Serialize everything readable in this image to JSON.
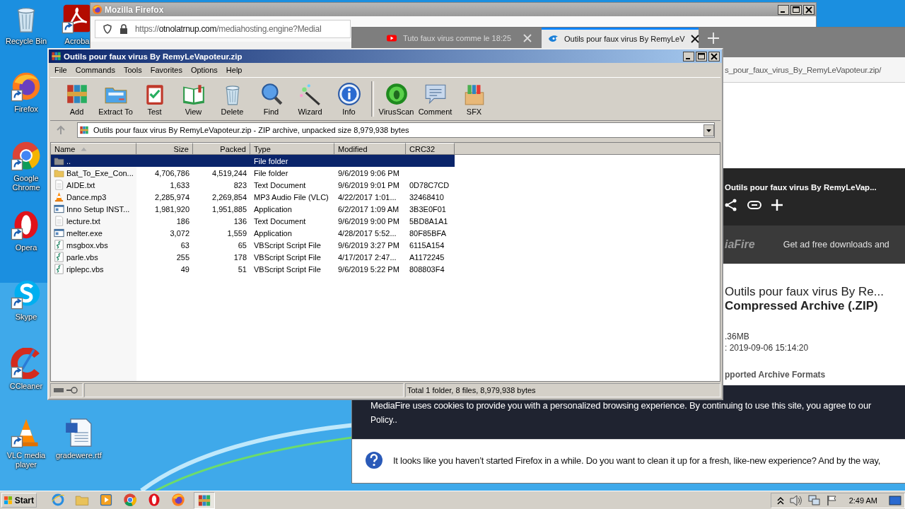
{
  "desktop_icons": [
    {
      "label": "Recycle Bin",
      "kind": "recycle",
      "shortcut": false
    },
    {
      "label": "Acroba",
      "kind": "acrobat",
      "shortcut": true
    },
    {
      "label": "Firefox",
      "kind": "firefox",
      "shortcut": true
    },
    {
      "label": "Google Chrome",
      "kind": "chrome",
      "shortcut": true
    },
    {
      "label": "Opera",
      "kind": "opera",
      "shortcut": true
    },
    {
      "label": "Skype",
      "kind": "skype",
      "shortcut": true
    },
    {
      "label": "CCleaner",
      "kind": "ccleaner",
      "shortcut": true
    },
    {
      "label": "VLC media player",
      "kind": "vlc",
      "shortcut": true
    },
    {
      "label": "gradewere.rtf",
      "kind": "worddoc",
      "shortcut": false
    }
  ],
  "browser_back": {
    "title": "Mozilla Firefox",
    "url_scheme": "https://",
    "url_host": "otnolatrnup.com",
    "url_path": "/mediahosting.engine?MediaI"
  },
  "browser_front": {
    "tabs": [
      {
        "label": "Tuto faux virus comme le 18:25",
        "kind": "youtube",
        "selected": false
      },
      {
        "label": "Outils pour faux virus By RemyLeV",
        "kind": "mediafire",
        "selected": true
      }
    ],
    "url": "s_pour_faux_virus_By_RemyLeVapoteur.zip/",
    "page": {
      "header_title": "Outils pour faux virus By RemyLeVap...",
      "brand": "iaFire",
      "promo": "Get ad free downloads and",
      "file_name": "Outils pour faux virus By Re...",
      "file_type": "Compressed Archive (.ZIP)",
      "size": ".36MB",
      "date": ": 2019-09-06 15:14:20",
      "section_heading": "pported Archive Formats",
      "cookie_text": "MediaFire uses cookies to provide you with a personalized browsing experience. By continuing to use this site, you agree to our",
      "cookie_link": "Policy.."
    },
    "notification": "It looks like you haven’t started Firefox in a while. Do you want to clean it up for a fresh, like-new experience? And by the way,"
  },
  "winrar": {
    "title": "Outils pour faux virus By RemyLeVapoteur.zip",
    "menu": [
      "File",
      "Commands",
      "Tools",
      "Favorites",
      "Options",
      "Help"
    ],
    "toolbar": [
      {
        "label": "Add",
        "kind": "add"
      },
      {
        "label": "Extract To",
        "kind": "extract"
      },
      {
        "label": "Test",
        "kind": "test"
      },
      {
        "label": "View",
        "kind": "view"
      },
      {
        "label": "Delete",
        "kind": "delete"
      },
      {
        "label": "Find",
        "kind": "find"
      },
      {
        "label": "Wizard",
        "kind": "wizard"
      },
      {
        "label": "Info",
        "kind": "info"
      },
      {
        "kind": "separator"
      },
      {
        "label": "VirusScan",
        "kind": "virusscan"
      },
      {
        "label": "Comment",
        "kind": "comment"
      },
      {
        "label": "SFX",
        "kind": "sfx"
      }
    ],
    "path": "Outils pour faux virus By RemyLeVapoteur.zip - ZIP archive, unpacked size 8,979,938 bytes",
    "columns": [
      {
        "label": "Name",
        "sorted": true
      },
      {
        "label": "Size",
        "sorted": false
      },
      {
        "label": "Packed",
        "sorted": false
      },
      {
        "label": "Type",
        "sorted": false
      },
      {
        "label": "Modified",
        "sorted": false
      },
      {
        "label": "CRC32",
        "sorted": false
      }
    ],
    "rows": [
      {
        "kind": "up",
        "name": "..",
        "size": "",
        "packed": "",
        "type": "File folder",
        "modified": "",
        "crc": "",
        "selected": true
      },
      {
        "kind": "folder",
        "name": "Bat_To_Exe_Con...",
        "size": "4,706,786",
        "packed": "4,519,244",
        "type": "File folder",
        "modified": "9/6/2019 9:06 PM",
        "crc": "",
        "selected": false
      },
      {
        "kind": "text",
        "name": "AIDE.txt",
        "size": "1,633",
        "packed": "823",
        "type": "Text Document",
        "modified": "9/6/2019 9:01 PM",
        "crc": "0D78C7CD",
        "selected": false
      },
      {
        "kind": "vlc",
        "name": "Dance.mp3",
        "size": "2,285,974",
        "packed": "2,269,854",
        "type": "MP3 Audio File (VLC)",
        "modified": "4/22/2017 1:01...",
        "crc": "32468410",
        "selected": false
      },
      {
        "kind": "app",
        "name": "Inno Setup INST...",
        "size": "1,981,920",
        "packed": "1,951,885",
        "type": "Application",
        "modified": "6/2/2017 1:09 AM",
        "crc": "3B3E0F01",
        "selected": false
      },
      {
        "kind": "text",
        "name": "lecture.txt",
        "size": "186",
        "packed": "136",
        "type": "Text Document",
        "modified": "9/6/2019 9:00 PM",
        "crc": "5BD8A1A1",
        "selected": false
      },
      {
        "kind": "app",
        "name": "melter.exe",
        "size": "3,072",
        "packed": "1,559",
        "type": "Application",
        "modified": "4/28/2017 5:52...",
        "crc": "80F85BFA",
        "selected": false
      },
      {
        "kind": "script",
        "name": "msgbox.vbs",
        "size": "63",
        "packed": "65",
        "type": "VBScript Script File",
        "modified": "9/6/2019 3:27 PM",
        "crc": "6115A154",
        "selected": false
      },
      {
        "kind": "script",
        "name": "parle.vbs",
        "size": "255",
        "packed": "178",
        "type": "VBScript Script File",
        "modified": "4/17/2017 2:47...",
        "crc": "A1172245",
        "selected": false
      },
      {
        "kind": "script",
        "name": "riplepc.vbs",
        "size": "49",
        "packed": "51",
        "type": "VBScript Script File",
        "modified": "9/6/2019 5:22 PM",
        "crc": "808803F4",
        "selected": false
      }
    ],
    "status": "Total 1 folder, 8 files, 8,979,938 bytes"
  },
  "taskbar": {
    "start": "Start",
    "apps": [
      {
        "kind": "ie",
        "active": false
      },
      {
        "kind": "explorer",
        "active": false
      },
      {
        "kind": "media",
        "active": false
      },
      {
        "kind": "chrome",
        "active": false
      },
      {
        "kind": "opera",
        "active": false
      },
      {
        "kind": "firefox",
        "active": false
      },
      {
        "kind": "winrar",
        "active": true
      }
    ],
    "clock": "2:49 AM"
  }
}
